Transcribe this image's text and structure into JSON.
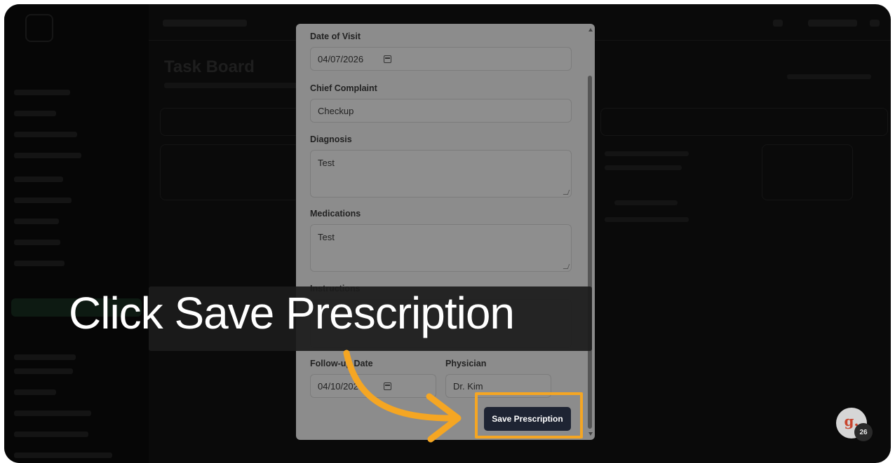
{
  "background": {
    "page_title": "Task Board"
  },
  "modal": {
    "date_of_visit": {
      "label": "Date of Visit",
      "value": "04/07/2026"
    },
    "chief_complaint": {
      "label": "Chief Complaint",
      "value": "Checkup"
    },
    "diagnosis": {
      "label": "Diagnosis",
      "value": "Test"
    },
    "medications": {
      "label": "Medications",
      "value": "Test"
    },
    "instructions": {
      "label": "Instructions"
    },
    "follow_up_date": {
      "label": "Follow-up Date",
      "value": "04/10/2026"
    },
    "physician": {
      "label": "Physician",
      "value": "Dr. Kim"
    },
    "save_label": "Save Prescription"
  },
  "caption": "Click Save Prescription",
  "widget": {
    "letter": "g.",
    "badge": "26"
  },
  "colors": {
    "highlight": "#f5a623",
    "button": "#1e2433",
    "overlay": "#0a0a0a"
  }
}
